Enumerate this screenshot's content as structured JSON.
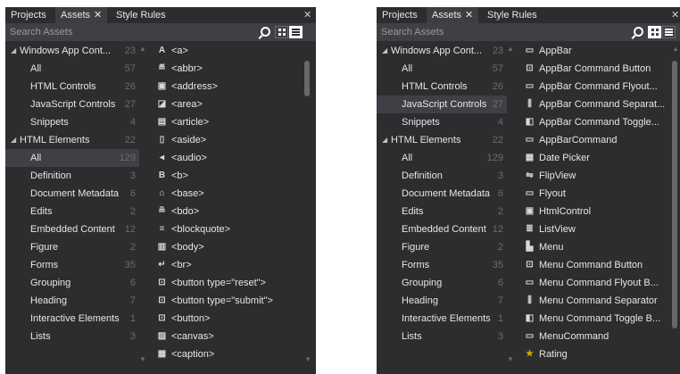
{
  "left_panel": {
    "tabs": {
      "projects": "Projects",
      "assets": "Assets",
      "close": "✕",
      "style_rules": "Style Rules"
    },
    "pin_close": "ᅟ⨯",
    "pin": "ᅟ",
    "search_placeholder": "Search Assets",
    "categories": [
      {
        "label": "Windows App Cont...",
        "count": "23",
        "expander": "◢",
        "level": 0
      },
      {
        "label": "All",
        "count": "57",
        "level": 1
      },
      {
        "label": "HTML Controls",
        "count": "26",
        "level": 1
      },
      {
        "label": "JavaScript Controls",
        "count": "27",
        "level": 1
      },
      {
        "label": "Snippets",
        "count": "4",
        "level": 1
      },
      {
        "label": "HTML Elements",
        "count": "22",
        "expander": "◢",
        "level": 0
      },
      {
        "label": "All",
        "count": "129",
        "level": 1
      },
      {
        "label": "Definition",
        "count": "3",
        "level": 1
      },
      {
        "label": "Document Metadata",
        "count": "6",
        "level": 1
      },
      {
        "label": "Edits",
        "count": "2",
        "level": 1
      },
      {
        "label": "Embedded Content",
        "count": "12",
        "level": 1
      },
      {
        "label": "Figure",
        "count": "2",
        "level": 1
      },
      {
        "label": "Forms",
        "count": "35",
        "level": 1
      },
      {
        "label": "Grouping",
        "count": "6",
        "level": 1
      },
      {
        "label": "Heading",
        "count": "7",
        "level": 1
      },
      {
        "label": "Interactive Elements",
        "count": "1",
        "level": 1
      },
      {
        "label": "Lists",
        "count": "3",
        "level": 1
      }
    ],
    "items": [
      {
        "icon": "A",
        "label": "<a>"
      },
      {
        "icon": "≝",
        "label": "<abbr>"
      },
      {
        "icon": "▣",
        "label": "<address>"
      },
      {
        "icon": "◪",
        "label": "<area>"
      },
      {
        "icon": "▤",
        "label": "<article>"
      },
      {
        "icon": "▯",
        "label": "<aside>"
      },
      {
        "icon": "◂",
        "label": "<audio>"
      },
      {
        "icon": "B",
        "label": "<b>"
      },
      {
        "icon": "⌂",
        "label": "<base>"
      },
      {
        "icon": "≞",
        "label": "<bdo>"
      },
      {
        "icon": "≡",
        "label": "<blockquote>"
      },
      {
        "icon": "▥",
        "label": "<body>"
      },
      {
        "icon": "↵",
        "label": "<br>"
      },
      {
        "icon": "⊡",
        "label": "<button type=\"reset\">"
      },
      {
        "icon": "⊡",
        "label": "<button type=\"submit\">"
      },
      {
        "icon": "⊡",
        "label": "<button>"
      },
      {
        "icon": "▨",
        "label": "<canvas>"
      },
      {
        "icon": "▦",
        "label": "<caption>"
      }
    ]
  },
  "right_panel": {
    "tabs": {
      "projects": "Projects",
      "assets": "Assets",
      "close": "✕",
      "style_rules": "Style Rules"
    },
    "pin": "ᅟ",
    "search_placeholder": "Search Assets",
    "categories": [
      {
        "label": "Windows App Cont...",
        "count": "23",
        "expander": "◢",
        "level": 0
      },
      {
        "label": "All",
        "count": "57",
        "level": 1
      },
      {
        "label": "HTML Controls",
        "count": "26",
        "level": 1
      },
      {
        "label": "JavaScript Controls",
        "count": "27",
        "level": 1
      },
      {
        "label": "Snippets",
        "count": "4",
        "level": 1
      },
      {
        "label": "HTML Elements",
        "count": "22",
        "expander": "◢",
        "level": 0
      },
      {
        "label": "All",
        "count": "129",
        "level": 1
      },
      {
        "label": "Definition",
        "count": "3",
        "level": 1
      },
      {
        "label": "Document Metadata",
        "count": "6",
        "level": 1
      },
      {
        "label": "Edits",
        "count": "2",
        "level": 1
      },
      {
        "label": "Embedded Content",
        "count": "12",
        "level": 1
      },
      {
        "label": "Figure",
        "count": "2",
        "level": 1
      },
      {
        "label": "Forms",
        "count": "35",
        "level": 1
      },
      {
        "label": "Grouping",
        "count": "6",
        "level": 1
      },
      {
        "label": "Heading",
        "count": "7",
        "level": 1
      },
      {
        "label": "Interactive Elements",
        "count": "1",
        "level": 1
      },
      {
        "label": "Lists",
        "count": "3",
        "level": 1
      }
    ],
    "items": [
      {
        "icon": "▭",
        "label": "AppBar"
      },
      {
        "icon": "⊡",
        "label": "AppBar Command Button"
      },
      {
        "icon": "▭",
        "label": "AppBar Command Flyout..."
      },
      {
        "icon": "⫼",
        "label": "AppBar Command Separat..."
      },
      {
        "icon": "◧",
        "label": "AppBar Command Toggle..."
      },
      {
        "icon": "▭",
        "label": "AppBarCommand"
      },
      {
        "icon": "▦",
        "label": "Date Picker"
      },
      {
        "icon": "⇋",
        "label": "FlipView"
      },
      {
        "icon": "▭",
        "label": "Flyout"
      },
      {
        "icon": "▣",
        "label": "HtmlControl"
      },
      {
        "icon": "≣",
        "label": "ListView"
      },
      {
        "icon": "▙",
        "label": "Menu"
      },
      {
        "icon": "⊡",
        "label": "Menu Command Button"
      },
      {
        "icon": "▭",
        "label": "Menu Command Flyout B..."
      },
      {
        "icon": "⫼",
        "label": "Menu Command Separator"
      },
      {
        "icon": "◧",
        "label": "Menu Command Toggle B..."
      },
      {
        "icon": "▭",
        "label": "MenuCommand"
      },
      {
        "icon": "★",
        "label": "Rating"
      }
    ]
  }
}
